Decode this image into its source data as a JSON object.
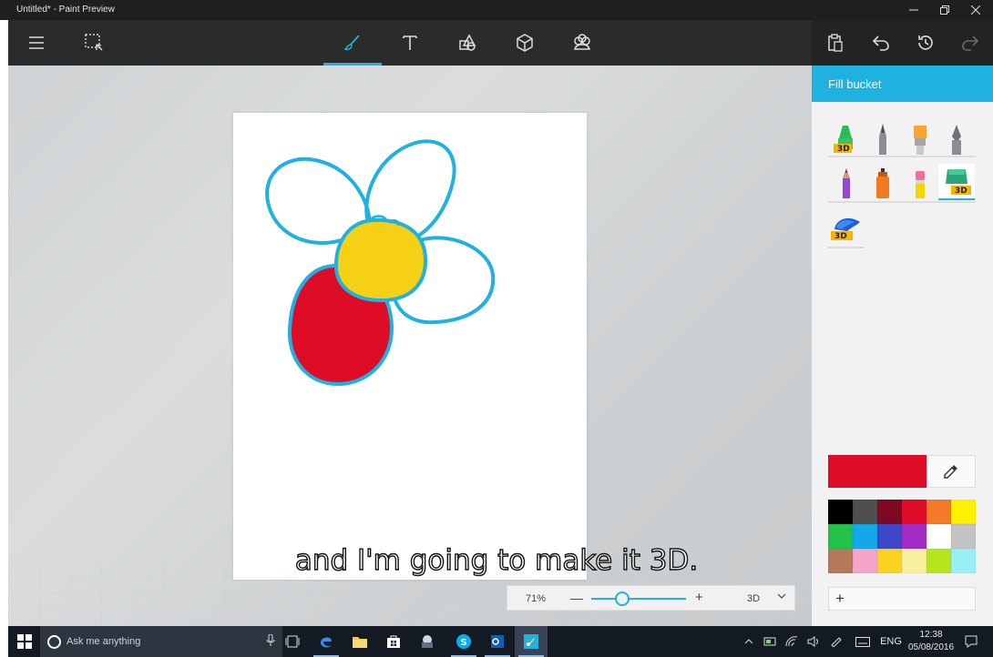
{
  "window": {
    "title": "Untitled* - Paint Preview"
  },
  "toolbar": {
    "left": [
      {
        "icon": "hamburger-menu-icon"
      },
      {
        "icon": "select-icon"
      }
    ],
    "center": [
      {
        "icon": "brush-icon",
        "active": true
      },
      {
        "icon": "text-icon"
      },
      {
        "icon": "2d-shapes-icon"
      },
      {
        "icon": "3d-objects-icon"
      },
      {
        "icon": "stickers-icon"
      }
    ],
    "right": [
      {
        "icon": "paste-icon"
      },
      {
        "icon": "undo-icon"
      },
      {
        "icon": "history-icon"
      },
      {
        "icon": "redo-icon"
      }
    ]
  },
  "panel": {
    "title": "Fill bucket",
    "tools": [
      "3d-marker-icon",
      "calligraphy-pen-icon",
      "oil-brush-icon",
      "fountain-pen-icon",
      "pencil-icon",
      "spray-can-icon",
      "eraser-icon",
      "3d-fill-bucket-icon",
      "3d-crayon-icon"
    ],
    "selected_tool": "3d-fill-bucket-icon",
    "current_color": "#de0c27",
    "palette": [
      "#000000",
      "#4f4f4f",
      "#7d0a22",
      "#de0c27",
      "#f27a2a",
      "#fff200",
      "#23c04a",
      "#14a8e8",
      "#3c48c8",
      "#a32cc4",
      "#ffffff",
      "#c3c3c3",
      "#b5795a",
      "#f4a5c8",
      "#fcd220",
      "#f8ef9c",
      "#b5e61d",
      "#99f0f4"
    ],
    "add_label": "+"
  },
  "subtitle": "and I'm going to make it 3D.",
  "zoom": {
    "value": "71%",
    "minus": "—",
    "plus": "+",
    "view": "3D",
    "level": 0.33
  },
  "taskbar": {
    "search_placeholder": "Ask me anything",
    "language": "ENG",
    "time": "12:38",
    "date": "05/08/2016"
  },
  "colors": {
    "accent": "#1fb1e0",
    "petal_outline": "#1fb1e0",
    "center": "#f5d016",
    "red_petal": "#de0c27"
  }
}
